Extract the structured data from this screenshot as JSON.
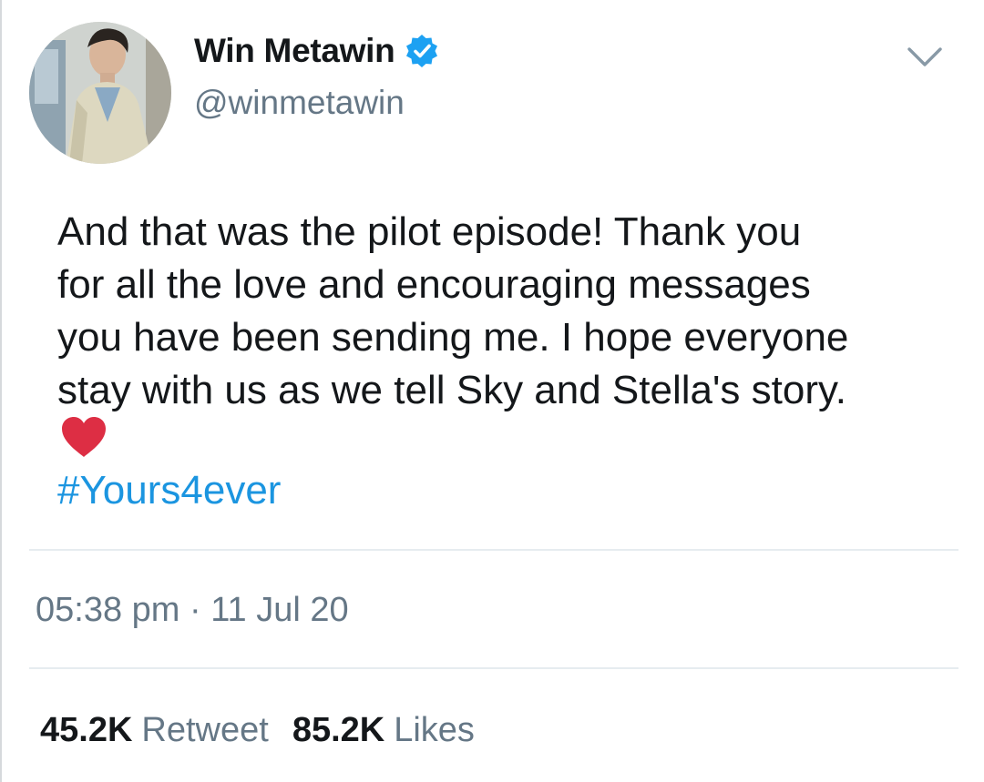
{
  "author": {
    "display_name": "Win Metawin",
    "handle": "@winmetawin",
    "verified": true,
    "verified_color": "#1da1f2"
  },
  "tweet": {
    "text": "And that was the pilot episode!  Thank you\nfor all the love and encouraging messages\nyou have been sending me. I hope everyone\nstay with us as we tell Sky and Stella's story.",
    "emoji": "heart",
    "hashtag": "#Yours4ever",
    "hashtag_color": "#1b95e0"
  },
  "meta": {
    "timestamp": "05:38 pm · 11 Jul 20"
  },
  "stats": {
    "retweets_count": "45.2K",
    "retweets_label": "Retweet",
    "likes_count": "85.2K",
    "likes_label": "Likes"
  },
  "icons": {
    "menu": "chevron-down-icon",
    "verified": "verified-badge-icon",
    "emoji": "red-heart-icon"
  }
}
